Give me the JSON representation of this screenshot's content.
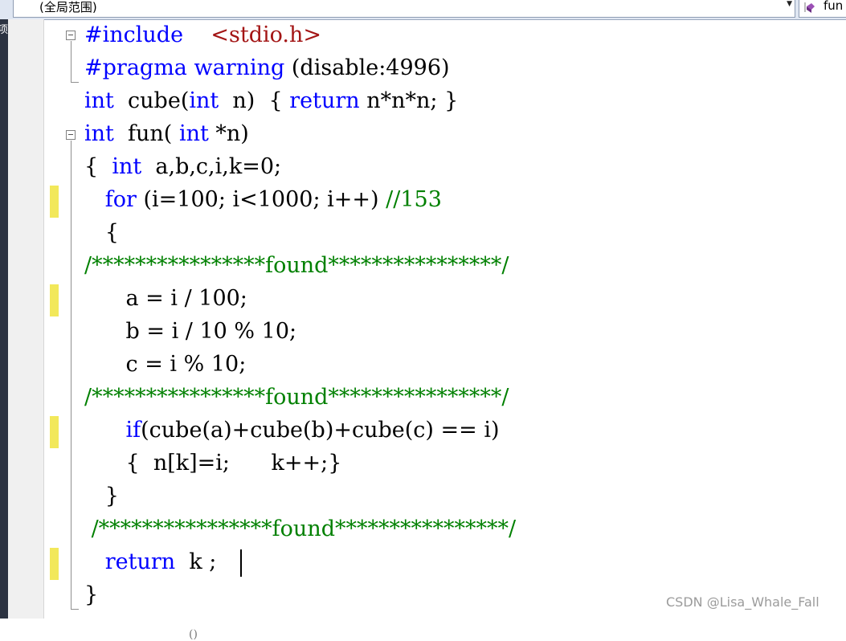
{
  "navbar": {
    "scope": "(全局范围)",
    "scope_arrow": "▼",
    "member": "fun",
    "member_icon": "method-icon"
  },
  "left_strip_char": "项",
  "colors": {
    "keyword": "#0000ff",
    "include_path": "#a31515",
    "comment": "#008000",
    "change_marker": "#f2e85a"
  },
  "code": {
    "l1": {
      "kw": "#include",
      "sp": "    ",
      "path": "<stdio.h>"
    },
    "l2": {
      "kw1": "#pragma",
      "sp1": " ",
      "kw2": "warning",
      "rest": " (disable:4996)"
    },
    "l3": {
      "kw1": "int",
      "a": "  cube(",
      "kw2": "int",
      "b": "  n)  { ",
      "kw3": "return",
      "c": " n*n*n; }"
    },
    "l4": {
      "kw1": "int",
      "a": "  fun( ",
      "kw2": "int",
      "b": " *n)"
    },
    "l5": {
      "a": "{  ",
      "kw": "int",
      "b": "  a,b,c,i,k=0;"
    },
    "l6": {
      "a": "   ",
      "kw": "for",
      "b": " (i=100; i<1000; i++) ",
      "cm": "//153"
    },
    "l7": {
      "a": "   {"
    },
    "l8": {
      "cm": "/****************found****************/"
    },
    "l9": {
      "a": "      a = i / 100;"
    },
    "l10": {
      "a": "      b = i / 10 % 10;"
    },
    "l11": {
      "a": "      c = i % 10;"
    },
    "l12": {
      "cm": "/****************found****************/"
    },
    "l13": {
      "a": "      ",
      "kw": "if",
      "b": "(cube(a)+cube(b)+cube(c) == i)"
    },
    "l14": {
      "a": "      {  n[k]=i;      k++;}"
    },
    "l15": {
      "a": "   }"
    },
    "l16": {
      "cm": " /****************found****************/"
    },
    "l17": {
      "a": "   ",
      "kw": "return",
      "b": "  k ;"
    },
    "l18": {
      "a": "}"
    }
  },
  "watermark": "CSDN @Lisa_Whale_Fall",
  "partial_bottom": "()"
}
